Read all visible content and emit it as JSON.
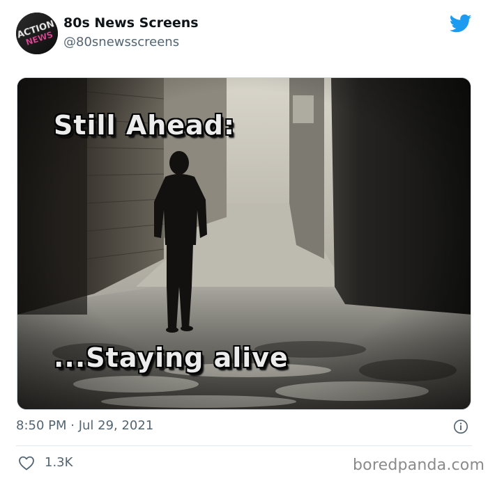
{
  "tweet": {
    "display_name": "80s News Screens",
    "handle": "@80snewsscreens",
    "avatar_text": [
      "ACTION",
      "NEWS"
    ],
    "icon": "twitter-bird-icon",
    "media": {
      "caption_top": "Still Ahead:",
      "caption_bottom": "...Staying alive"
    },
    "timestamp": "8:50 PM · Jul 29, 2021",
    "info_icon": "info-icon",
    "likes": "1.3K",
    "like_icon": "heart-icon"
  },
  "watermark": "boredpanda.com",
  "colors": {
    "twitter_blue": "#1d9bf0",
    "secondary_text": "#536471",
    "primary_text": "#0f1419",
    "avatar_pink": "#e0509a"
  }
}
